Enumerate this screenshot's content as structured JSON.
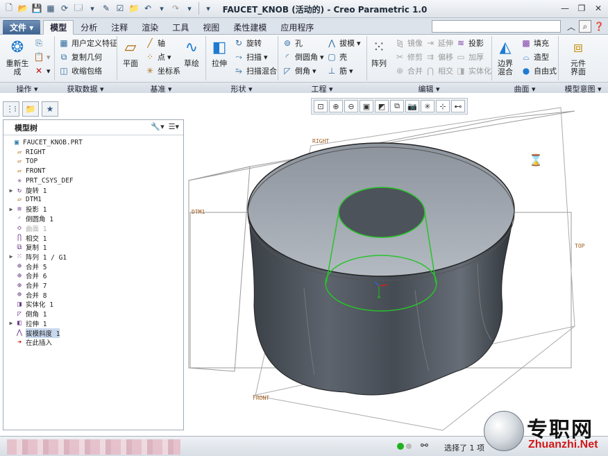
{
  "window": {
    "title": "FAUCET_KNOB (活动的) - Creo Parametric 1.0"
  },
  "tabs": [
    "文件",
    "模型",
    "分析",
    "注释",
    "渲染",
    "工具",
    "视图",
    "柔性建模",
    "应用程序"
  ],
  "ribbon": {
    "regen": "重新生\n成",
    "user_feature": "用户定义特征",
    "copy_geom": "复制几何",
    "shrinkwrap": "收缩包络",
    "plane": "平面",
    "axis": "轴",
    "point": "点",
    "csys": "坐标系",
    "sketch": "草绘",
    "extrude": "拉伸",
    "revolve": "旋转",
    "sweep": "扫描",
    "swept_blend": "扫描混合",
    "hole": "孔",
    "round": "倒圆角",
    "chamfer": "倒角",
    "draft": "拔模",
    "shell": "壳",
    "rib": "筋",
    "pattern": "阵列",
    "mirror": "镜像",
    "trim": "修剪",
    "merge": "合并",
    "extend": "延伸",
    "offset": "偏移",
    "intersect": "相交",
    "project": "投影",
    "thicken": "加厚",
    "solidify": "实体化",
    "boundary_blend": "边界\n混合",
    "fill": "填充",
    "style": "造型",
    "freestyle": "自由式",
    "component_interface": "元件\n界面"
  },
  "groups": [
    "操作",
    "获取数据",
    "基准",
    "形状",
    "工程",
    "编辑",
    "曲面",
    "模型意图"
  ],
  "model_tree": {
    "title": "模型树",
    "items": [
      {
        "label": "FAUCET_KNOB.PRT",
        "icon": "part-icon",
        "exp": ""
      },
      {
        "label": "RIGHT",
        "icon": "datum-plane-icon",
        "exp": ""
      },
      {
        "label": "TOP",
        "icon": "datum-plane-icon",
        "exp": ""
      },
      {
        "label": "FRONT",
        "icon": "datum-plane-icon",
        "exp": ""
      },
      {
        "label": "PRT_CSYS_DEF",
        "icon": "csys-icon",
        "exp": ""
      },
      {
        "label": "旋转 1",
        "icon": "revolve-icon",
        "exp": "▶"
      },
      {
        "label": "DTM1",
        "icon": "datum-plane-icon",
        "exp": ""
      },
      {
        "label": "投影 1",
        "icon": "project-icon",
        "exp": "▶"
      },
      {
        "label": "倒圆角 1",
        "icon": "round-icon",
        "exp": ""
      },
      {
        "label": "曲面 1",
        "icon": "surface-icon",
        "exp": ""
      },
      {
        "label": "相交 1",
        "icon": "intersect-icon",
        "exp": ""
      },
      {
        "label": "复制 1",
        "icon": "copy-icon",
        "exp": ""
      },
      {
        "label": "阵列 1 / G1",
        "icon": "pattern-icon",
        "exp": "▶"
      },
      {
        "label": "合并 5",
        "icon": "merge-icon",
        "exp": ""
      },
      {
        "label": "合并 6",
        "icon": "merge-icon",
        "exp": ""
      },
      {
        "label": "合并 7",
        "icon": "merge-icon",
        "exp": ""
      },
      {
        "label": "合并 8",
        "icon": "merge-icon",
        "exp": ""
      },
      {
        "label": "实体化 1",
        "icon": "solidify-icon",
        "exp": ""
      },
      {
        "label": "倒角 1",
        "icon": "chamfer-icon",
        "exp": ""
      },
      {
        "label": "拉伸 1",
        "icon": "extrude-icon",
        "exp": "▶"
      },
      {
        "label": "拔模斜度 1",
        "icon": "draft-icon",
        "exp": ""
      },
      {
        "label": "在此插入",
        "icon": "insert-here-icon",
        "exp": ""
      }
    ]
  },
  "viewport": {
    "datum_labels": {
      "right": "RIGHT",
      "dtm1": "DTM1",
      "top": "TOP",
      "front": "FRONT"
    }
  },
  "status": {
    "selected": "选择了 1 项"
  },
  "watermark": {
    "cn": "专职网",
    "en": "Zhuanzhi.Net"
  }
}
